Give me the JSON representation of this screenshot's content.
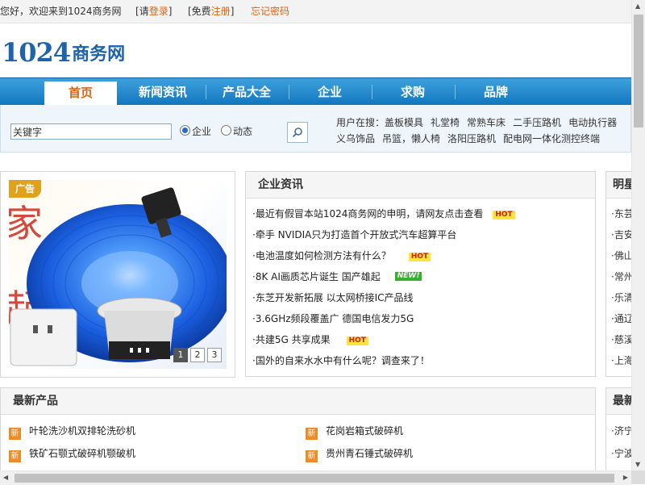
{
  "topbar": {
    "greeting": "您好，欢迎来到1024商务网",
    "login_prefix": "[请",
    "login_link": "登录",
    "login_suffix": "]",
    "register_prefix": "[免费",
    "register_link": "注册",
    "register_suffix": "]",
    "forgot_password": "忘记密码"
  },
  "logo": {
    "number": "1024",
    "text": "商务网"
  },
  "nav": {
    "items": [
      {
        "label": "首页",
        "active": true
      },
      {
        "label": "新闻资讯"
      },
      {
        "label": "产品大全"
      },
      {
        "label": "企业"
      },
      {
        "label": "求购"
      },
      {
        "label": "品牌"
      }
    ]
  },
  "search": {
    "input_value": "关键字",
    "radio_company": "企业",
    "radio_news": "动态",
    "hot_label": "用户在搜：",
    "hot_terms": [
      "盖板模具",
      "礼堂椅",
      "常熟车床",
      "二手压路机",
      "电动执行器",
      "义乌饰品",
      "吊篮，懒人椅",
      "洛阳压路机",
      "配电网一体化测控终端"
    ]
  },
  "ad": {
    "label": "广告",
    "pages": [
      "1",
      "2",
      "3"
    ],
    "current_page": "1"
  },
  "news": {
    "title": "企业资讯",
    "items": [
      {
        "text": "最近有假冒本站1024商务网的申明，请网友点击查看",
        "badge": "HOT"
      },
      {
        "text": "牵手 NVIDIA只为打造首个开放式汽车超算平台",
        "badge": ""
      },
      {
        "text": "电池温度如何检测方法有什么？",
        "badge": "HOT"
      },
      {
        "text": "8K AI画质芯片诞生 国产雄起",
        "badge": "NEW!"
      },
      {
        "text": "东芝开发新拓展 以太网桥接IC产品线",
        "badge": ""
      },
      {
        "text": "3.6GHz频段覆盖广 德国电信发力5G",
        "badge": ""
      },
      {
        "text": "共建5G 共享成果",
        "badge": "HOT"
      },
      {
        "text": "国外的自来水水中有什么呢？调查来了！",
        "badge": ""
      }
    ]
  },
  "brand": {
    "title": "明星",
    "items": [
      "东芸",
      "吉安",
      "佛山",
      "常州",
      "乐清",
      "通辽",
      "慈溪",
      "上海"
    ]
  },
  "products": {
    "title": "最新产品",
    "badge": "新",
    "items": [
      "叶轮洗沙机双排轮洗砂机",
      "花岗岩箱式破碎机",
      "铁矿石颚式破碎机颚破机",
      "贵州青石锤式破碎机"
    ]
  },
  "latest": {
    "title": "最新",
    "items": [
      "济宁",
      "宁波"
    ]
  },
  "colors": {
    "brand_blue": "#1e63ab",
    "nav_blue": "#0f75bd",
    "accent_orange": "#e0620d"
  }
}
